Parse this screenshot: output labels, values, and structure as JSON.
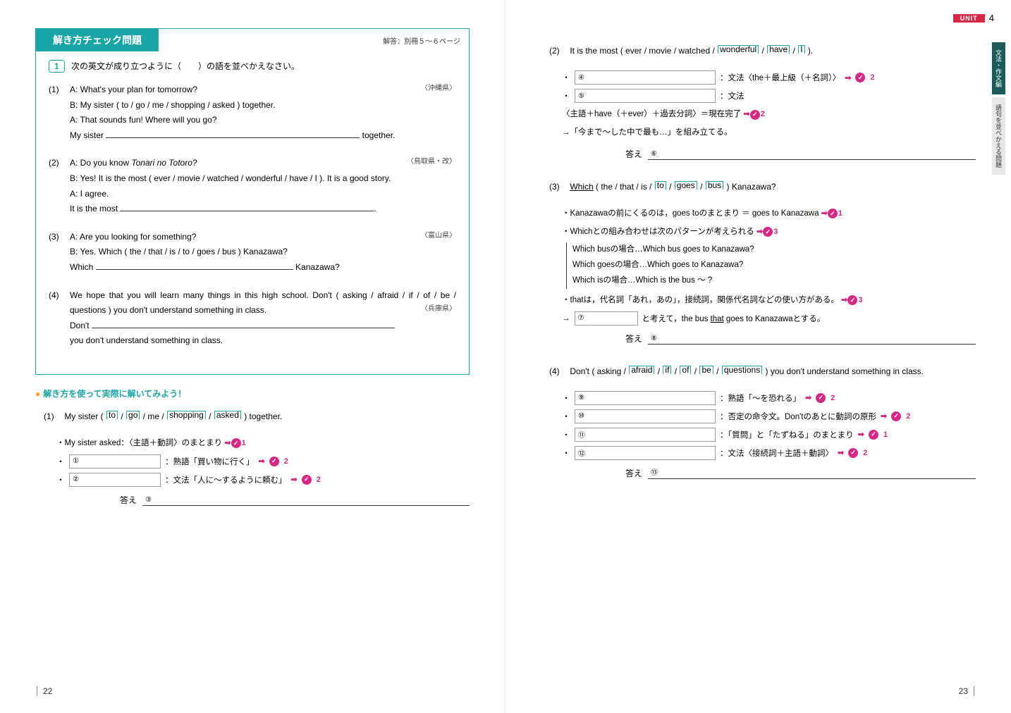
{
  "unit": {
    "label": "UNIT",
    "number": "4"
  },
  "side_tabs": [
    "文法・作文編",
    "語句を並べかえる問題"
  ],
  "check": {
    "title": "解き方チェック問題",
    "ref": "解答：別冊５〜６ページ",
    "qlabel": "1",
    "instruction": "次の英文が成り立つように（　　）の語を並べかえなさい。",
    "items": [
      {
        "n": "(1)",
        "pref": "〈沖縄県〉",
        "lines": [
          "A: What's your plan for tomorrow?",
          "B: My sister ( to / go / me / shopping / asked ) together.",
          "A: That sounds fun!  Where will you go?"
        ],
        "blank_pre": "My sister ",
        "blank_post": " together."
      },
      {
        "n": "(2)",
        "pref": "〈鳥取県・改〉",
        "lines": [
          "A: Do you know ",
          "B: Yes!  It is the most ( ever / movie / watched / wonderful / have / I ).  It is a good story.",
          "A: I agree."
        ],
        "italic_title": "Tonari no Totoro?",
        "blank_pre": "It is the most ",
        "blank_post": "."
      },
      {
        "n": "(3)",
        "pref": "〈富山県〉",
        "lines": [
          "A: Are you looking for something?",
          "B: Yes.  Which ( the / that / is / to / goes / bus ) Kanazawa?"
        ],
        "blank_pre": "Which ",
        "blank_post": " Kanazawa?"
      },
      {
        "n": "(4)",
        "pref": "〈兵庫県〉",
        "lines": [
          "We hope that you will learn many things in this high school.  Don't ( asking / afraid / if / of / be / questions ) you don't understand something in class."
        ],
        "blank_pre": "Don't ",
        "blank_post": "",
        "trail": "you don't understand something in class."
      }
    ]
  },
  "practice": {
    "title": "解き方を使って実際に解いてみよう！",
    "p1": {
      "num": "(1)",
      "sentence_pre": "My sister ( ",
      "words": [
        "to",
        "go",
        "me",
        "shopping",
        "asked"
      ],
      "sentence_post": " ) together.",
      "hint_lead": "・My sister asked：〈主語＋動詞〉のまとまり",
      "hints": [
        {
          "circ": "①",
          "txt": "：熟語「買い物に行く」",
          "cn": "2"
        },
        {
          "circ": "②",
          "txt": "：文法「人に〜するように頼む」",
          "cn": "2"
        }
      ],
      "lead_cn": "1",
      "answer_label": "答え",
      "answer_circ": "③"
    },
    "p2": {
      "num": "(2)",
      "sentence_pre": "It is the most ( ",
      "words": [
        "ever",
        "movie",
        "watched",
        "wonderful",
        "have",
        "I"
      ],
      "sentence_post": " ).",
      "hints": [
        {
          "circ": "④",
          "txt": "：文法〈the＋最上級（＋名詞）〉",
          "cn": "2"
        },
        {
          "circ": "⑤",
          "txt": "：文法",
          "cn": null
        }
      ],
      "extra1": "〈主語＋have（＋ever）＋過去分詞〉＝現在完了",
      "extra1_cn": "2",
      "extra2": "→「今まで〜した中で最も…」を組み立てる。",
      "answer_label": "答え",
      "answer_circ": "⑥"
    },
    "p3": {
      "num": "(3)",
      "sentence_pre_u": "Which",
      "sentence_mid": " ( the / that / is / ",
      "words_b": [
        "to",
        "goes",
        "bus"
      ],
      "sentence_post": " ) Kanazawa?",
      "line1": "・Kanazawaの前にくるのは，goes toのまとまり ＝ goes to Kanazawa",
      "line1_cn": "1",
      "line2": "・Whichとの組み合わせは次のパターンが考えられる",
      "line2_cn": "3",
      "brace": [
        "Which busの場合…Which bus goes to Kanazawa?",
        "Which goesの場合…Which goes to Kanazawa?",
        "Which isの場合…Which is the bus 〜 ?"
      ],
      "line3": "・thatは，代名詞「あれ，あの」，接続詞，関係代名詞などの使い方がある。",
      "line3_cn": "3",
      "line4_pre": "→",
      "line4_circ": "⑦",
      "line4_post": "と考えて，the bus that goes to Kanazawaとする。",
      "line4_u": "that",
      "answer_label": "答え",
      "answer_circ": "⑧"
    },
    "p4": {
      "num": "(4)",
      "sentence_pre": "Don't ( ",
      "words": [
        "asking",
        "afraid",
        "if",
        "of",
        "be",
        "questions"
      ],
      "sentence_post": " ) you don't understand something in class.",
      "hints": [
        {
          "circ": "⑨",
          "txt": "：熟語「〜を恐れる」",
          "cn": "2"
        },
        {
          "circ": "⑩",
          "txt": "：否定の命令文。Don'tのあとに動詞の原形",
          "cn": "2"
        },
        {
          "circ": "⑪",
          "txt": "：「質問」と「たずねる」のまとまり",
          "cn": "1"
        },
        {
          "circ": "⑫",
          "txt": "：文法〈接続詞＋主語＋動詞〉",
          "cn": "2"
        }
      ],
      "answer_label": "答え",
      "answer_circ": "⑬"
    }
  },
  "page_numbers": {
    "left": "22",
    "right": "23"
  }
}
